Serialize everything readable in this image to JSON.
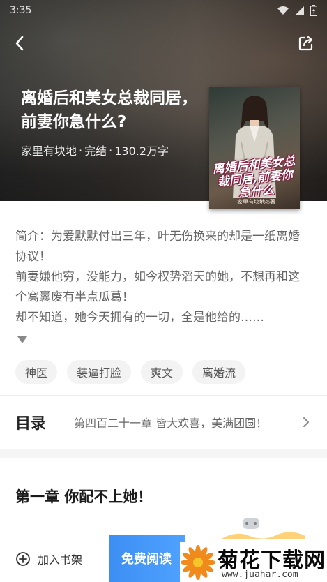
{
  "status_bar": {
    "time": "3:35"
  },
  "header": {
    "back_icon": "chevron-left-icon",
    "share_icon": "share-icon"
  },
  "book": {
    "title": "离婚后和美女总裁同居，前妻你急什么?",
    "author": "家里有块地",
    "status": "完结",
    "word_count": "130.2万字",
    "separator": "·"
  },
  "cover": {
    "title": "离婚后和美女总裁同居,前妻你急什么",
    "author_line": "家里有块地◎著"
  },
  "synopsis": {
    "lines": [
      "简介：为爱默默付出三年，叶无伤换来的却是一纸离婚协议！",
      "前妻嫌他穷，没能力，如今权势滔天的她，不想再和这个窝囊废有半点瓜葛！",
      "却不知道，她今天拥有的一切，全是他给的……"
    ]
  },
  "tags": [
    "神医",
    "装逼打脸",
    "爽文",
    "离婚流"
  ],
  "toc": {
    "label": "目录",
    "latest_chapter": "第四百二十一章 皆大欢喜，美满团圆！"
  },
  "chapter_preview": {
    "title": "第一章  你配不上她！"
  },
  "bottom_bar": {
    "add_shelf_label": "加入书架",
    "read_label": "免费阅读"
  },
  "watermark": {
    "title": "菊花下载网",
    "url": "www.juahar.com"
  },
  "colors": {
    "accent_blue": "#3d8ef3",
    "tag_bg": "#f3f3f3"
  }
}
